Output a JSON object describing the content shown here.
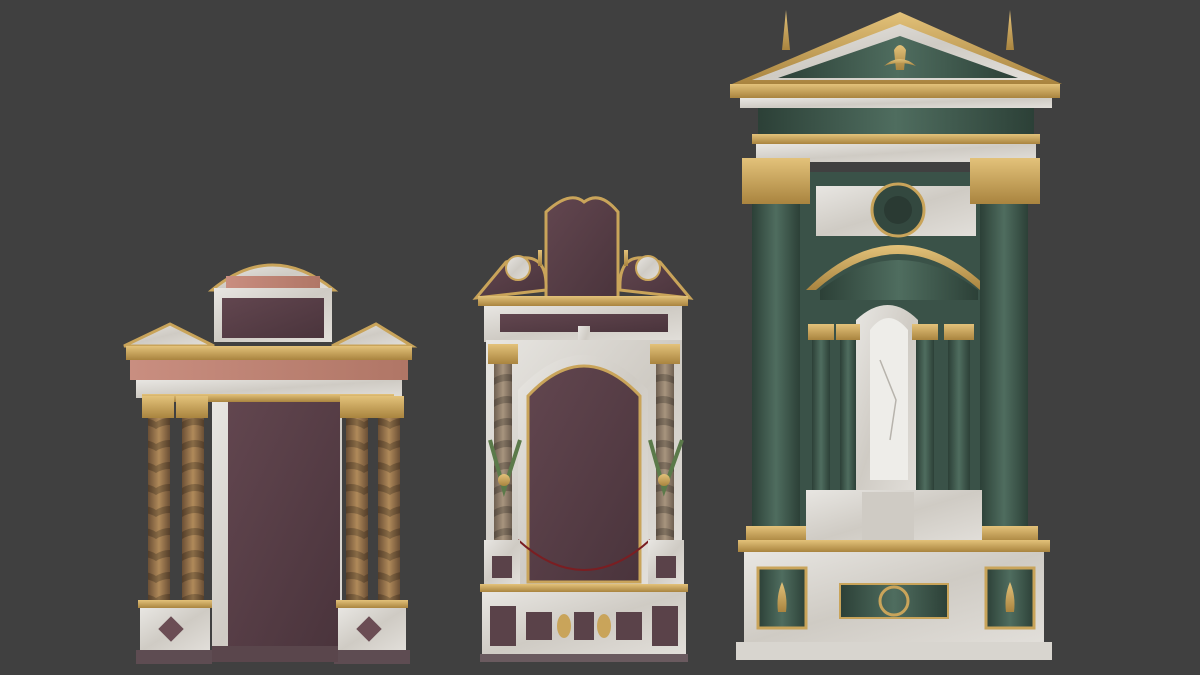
{
  "scene": {
    "background_color": "#404040",
    "objects": [
      {
        "name": "altar-frame-left",
        "style": "twin solomonic columns with broken pediments and a porphyry panel",
        "colors": {
          "marble": "#d9d6d0",
          "gold": "#c9a45a",
          "porphyry": "#5a3e46",
          "rose": "#b88072",
          "column": "#8a6b4a"
        }
      },
      {
        "name": "altar-frame-middle",
        "style": "volute-crowned frame with arched porphyry niche and carved twisted columns",
        "colors": {
          "marble": "#dcd8d2",
          "gold": "#c9a45a",
          "porphyry": "#4f3a44",
          "column": "#8f7a66",
          "green": "#5b7a4a",
          "red": "#7a1e22"
        }
      },
      {
        "name": "altar-frame-right",
        "style": "tall green-marble aedicula with triangular pediment, fleur-de-lis and arched niche",
        "colors": {
          "marble": "#e2e0dc",
          "gold": "#c9a45a",
          "green": "#3f5a4e",
          "green_dark": "#2f453c"
        }
      }
    ]
  }
}
